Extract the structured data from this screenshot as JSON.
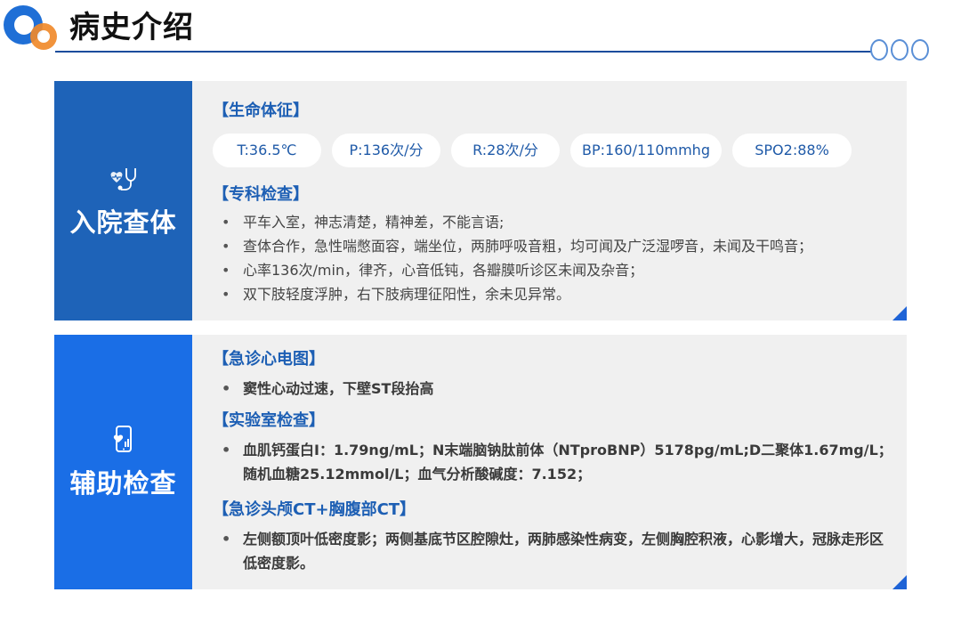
{
  "header": {
    "title": "病史介绍"
  },
  "panel1": {
    "side_title": "入院查体",
    "vitals_title": "【生命体征】",
    "vitals": [
      "T:36.5℃",
      "P:136次/分",
      "R:28次/分",
      "BP:160/110mmhg",
      "SPO2:88%"
    ],
    "exam_title": "【专科检查】",
    "exam_items": [
      "平车入室，神志清楚，精神差，不能言语;",
      "查体合作，急性喘憋面容，端坐位，两肺呼吸音粗，均可闻及广泛湿啰音，未闻及干鸣音；",
      "心率136次/min，律齐，心音低钝，各瓣膜听诊区未闻及杂音；",
      "双下肢轻度浮肿，右下肢病理征阳性，余未见异常。"
    ]
  },
  "panel2": {
    "side_title": "辅助检查",
    "ecg_title": "【急诊心电图】",
    "ecg_items": [
      "窦性心动过速，下壁ST段抬高"
    ],
    "lab_title": "【实验室检查】",
    "lab_items": [
      "血肌钙蛋白I：1.79ng/mL；N末端脑钠肽前体（NTproBNP）5178pg/mL;D二聚体1.67mg/L；随机血糖25.12mmol/L；血气分析酸碱度：7.152；"
    ],
    "ct_title": "【急诊头颅CT+胸腹部CT】",
    "ct_items": [
      "左侧额顶叶低密度影；两侧基底节区腔隙灶，两肺感染性病变，左侧胸腔积液，心影增大，冠脉走形区低密度影。"
    ]
  }
}
